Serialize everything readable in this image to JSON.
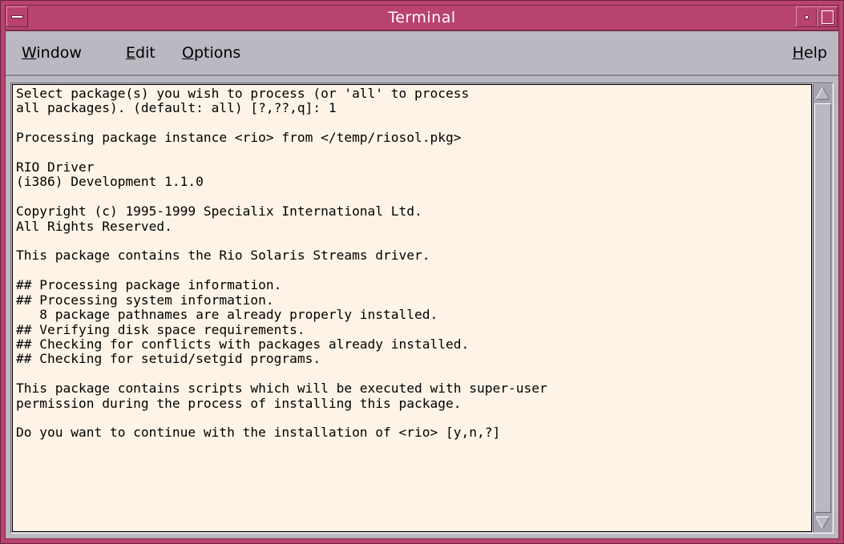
{
  "window": {
    "title": "Terminal"
  },
  "menubar": {
    "window": {
      "mnemonic": "W",
      "rest": "indow"
    },
    "edit": {
      "mnemonic": "E",
      "rest": "dit"
    },
    "options": {
      "mnemonic": "O",
      "rest": "ptions"
    },
    "help": {
      "mnemonic": "H",
      "rest": "elp"
    }
  },
  "terminal": {
    "lines": [
      "Select package(s) you wish to process (or 'all' to process",
      "all packages). (default: all) [?,??,q]: 1",
      "",
      "Processing package instance <rio> from </temp/riosol.pkg>",
      "",
      "RIO Driver",
      "(i386) Development 1.1.0",
      "",
      "Copyright (c) 1995-1999 Specialix International Ltd.",
      "All Rights Reserved.",
      "",
      "This package contains the Rio Solaris Streams driver.",
      "",
      "## Processing package information.",
      "## Processing system information.",
      "   8 package pathnames are already properly installed.",
      "## Verifying disk space requirements.",
      "## Checking for conflicts with packages already installed.",
      "## Checking for setuid/setgid programs.",
      "",
      "This package contains scripts which will be executed with super-user",
      "permission during the process of installing this package.",
      "",
      "Do you want to continue with the installation of <rio> [y,n,?]"
    ]
  },
  "colors": {
    "titlebar": "#b8436e",
    "chrome": "#bcb8c2",
    "terminal_bg": "#fdf3e6",
    "text": "#000000"
  },
  "icons": {
    "window_menu": "window-menu-icon",
    "minimize": "minimize-icon",
    "maximize": "maximize-icon",
    "scroll_up": "scroll-up-arrow-icon",
    "scroll_down": "scroll-down-arrow-icon"
  }
}
